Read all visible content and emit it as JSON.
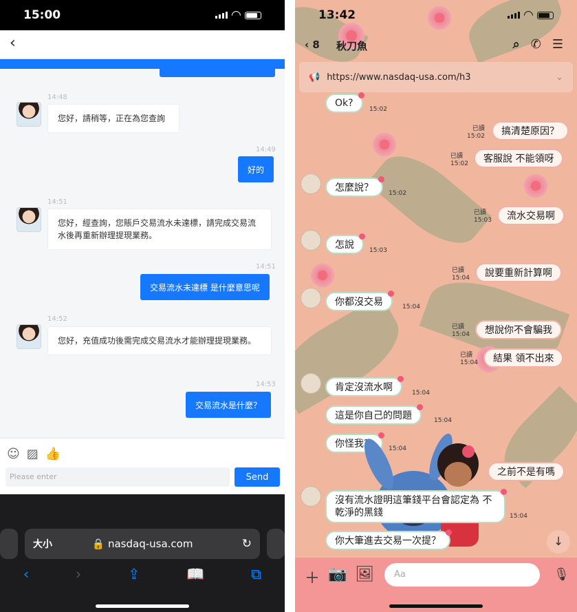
{
  "left": {
    "status_time": "15:00",
    "back_icon": "chevron-left-icon",
    "messages": [
      {
        "time": "14:48",
        "text": "您好，請稍等，正在為您查詢"
      },
      {
        "time": "14:49",
        "text": "好的"
      },
      {
        "time": "14:51",
        "text": "您好，經查詢，您賬戶交易流水未達標，請完成交易流水後再重新辦理提現業務。"
      },
      {
        "time": "14:51",
        "text": "交易流水未達標 是什麼意思呢"
      },
      {
        "time": "14:52",
        "text": "您好，充值成功後需完成交易流水才能辦理提現業務。"
      },
      {
        "time": "14:53",
        "text": "交易流水是什麼？"
      }
    ],
    "toolbar_icons": [
      "emoji-icon",
      "image-icon",
      "thumbs-up-icon"
    ],
    "input_placeholder": "Please enter",
    "send_label": "Send",
    "safari": {
      "aa": "大小",
      "url": "nasdaq-usa.com"
    },
    "accent": "#1677ff"
  },
  "right": {
    "status_time": "13:42",
    "back_count": "8",
    "title": "秋刀魚",
    "announcement": "https://www.nasdaq-usa.com/h3",
    "read_label": "已讀",
    "messages": [
      {
        "side": "in",
        "text": "Ok?",
        "time": "15:02"
      },
      {
        "side": "out",
        "text": "搞清楚原因？",
        "time": "15:02"
      },
      {
        "side": "out",
        "text": "客服說 不能領呀",
        "time": "15:02"
      },
      {
        "side": "in",
        "text": "怎麼說？",
        "time": "15:02"
      },
      {
        "side": "out",
        "text": "流水交易啊",
        "time": "15:03"
      },
      {
        "side": "in",
        "text": "怎說",
        "time": "15:03"
      },
      {
        "side": "out",
        "text": "說要重新計算啊",
        "time": "15:04"
      },
      {
        "side": "in",
        "text": "你都沒交易",
        "time": "15:04"
      },
      {
        "side": "out",
        "text": "想說你不會騙我",
        "time": "15:04"
      },
      {
        "side": "out",
        "text": "結果 領不出來",
        "time": "15:04"
      },
      {
        "side": "in",
        "text": "肯定沒流水啊",
        "time": "15:04"
      },
      {
        "side": "in",
        "text": "這是你自己的問題",
        "time": "15:04"
      },
      {
        "side": "in",
        "text": "你怪我？",
        "time": "15:04"
      },
      {
        "side": "out",
        "text": "之前不是有嗎",
        "time": ""
      },
      {
        "side": "in",
        "text": "沒有流水證明這筆錢平台會認定為 不乾淨的黑錢",
        "time": "15:04"
      },
      {
        "side": "in",
        "text": "你大筆進去交易一次提？",
        "time": ""
      }
    ],
    "input_placeholder": "Aa",
    "bubble_border": "#b9dcc2",
    "footer_color": "#f49596"
  }
}
